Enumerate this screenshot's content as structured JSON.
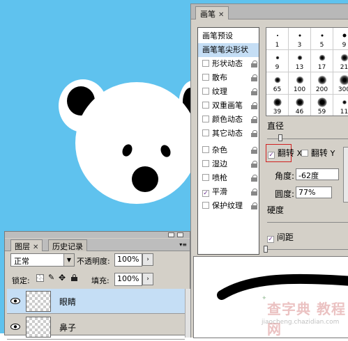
{
  "brush_panel": {
    "tab_label": "画笔",
    "list": [
      {
        "label": "画笔预设",
        "checkbox": false,
        "lock": false,
        "selected": false
      },
      {
        "label": "画笔笔尖形状",
        "checkbox": false,
        "lock": false,
        "selected": true
      },
      {
        "label": "形状动态",
        "checkbox": true,
        "checked": false,
        "lock": true
      },
      {
        "label": "散布",
        "checkbox": true,
        "checked": false,
        "lock": true
      },
      {
        "label": "纹理",
        "checkbox": true,
        "checked": false,
        "lock": true
      },
      {
        "label": "双重画笔",
        "checkbox": true,
        "checked": false,
        "lock": true
      },
      {
        "label": "颜色动态",
        "checkbox": true,
        "checked": false,
        "lock": true
      },
      {
        "label": "其它动态",
        "checkbox": true,
        "checked": false,
        "lock": true
      },
      {
        "label": "杂色",
        "checkbox": true,
        "checked": false,
        "lock": true
      },
      {
        "label": "湿边",
        "checkbox": true,
        "checked": false,
        "lock": true
      },
      {
        "label": "喷枪",
        "checkbox": true,
        "checked": false,
        "lock": true
      },
      {
        "label": "平滑",
        "checkbox": true,
        "checked": true,
        "lock": true
      },
      {
        "label": "保护纹理",
        "checkbox": true,
        "checked": false,
        "lock": true
      }
    ],
    "tip_sizes": [
      "1",
      "3",
      "5",
      "9",
      "9",
      "13",
      "17",
      "21",
      "65",
      "100",
      "200",
      "300",
      "39",
      "46",
      "59",
      "11"
    ],
    "diameter_label": "直径",
    "flip_x_label": "翻转",
    "flip_x_axis": "X",
    "flip_x_checked": true,
    "flip_y_label": "翻转",
    "flip_y_axis": "Y",
    "flip_y_checked": false,
    "angle_label": "角度:",
    "angle_value": "-62度",
    "roundness_label": "圆度:",
    "roundness_value": "77%",
    "hardness_label": "硬度",
    "spacing_label": "间距",
    "spacing_checked": true
  },
  "layers_panel": {
    "tabs": [
      "图层",
      "历史记录"
    ],
    "blend_mode": "正常",
    "opacity_label": "不透明度:",
    "opacity_value": "100%",
    "lock_label": "锁定:",
    "fill_label": "填充:",
    "fill_value": "100%",
    "layers": [
      {
        "name": "眼睛",
        "selected": true
      },
      {
        "name": "鼻子",
        "selected": false
      }
    ]
  },
  "watermark": {
    "text": "查字典 教程网",
    "url": "jiaocheng.chazidian.com"
  },
  "colors": {
    "canvas_bg": "#5fc2ee",
    "panel_bg": "#d4d0c8",
    "selection": "#c5def5"
  }
}
